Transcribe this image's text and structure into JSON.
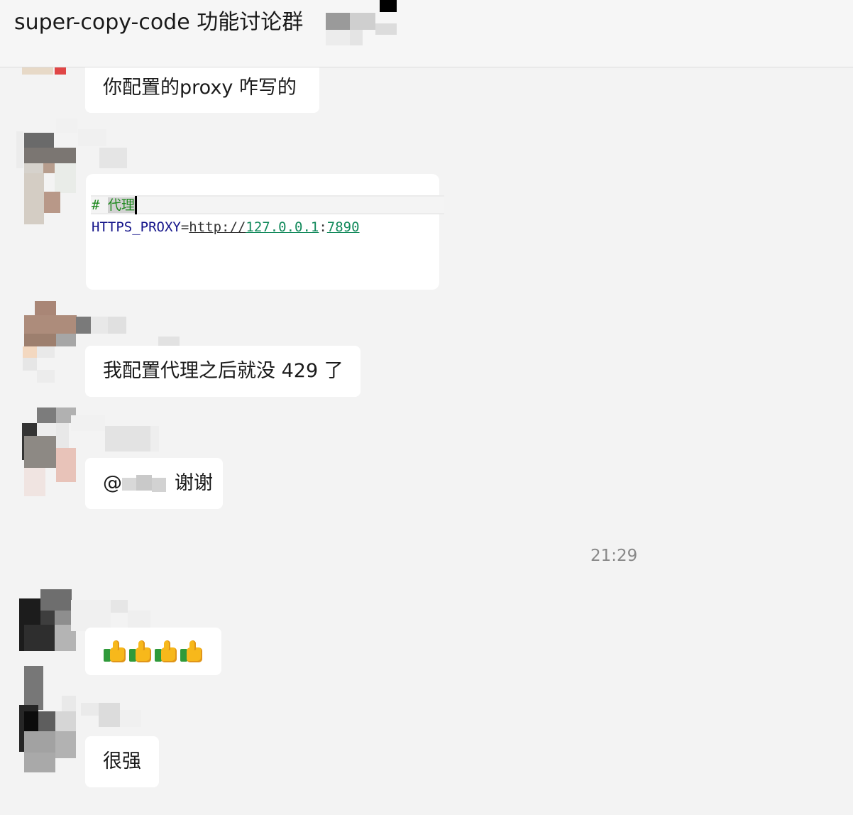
{
  "header": {
    "title": "super-copy-code 功能讨论群"
  },
  "messages": [
    {
      "text": "你配置的proxy 咋写的"
    },
    {
      "code": {
        "comment_hash": "# ",
        "comment_word": "代理",
        "key": "HTTPS_PROXY",
        "eq": "=",
        "scheme": "http://",
        "host": "127.0.0.1",
        "colon": ":",
        "port": "7890"
      }
    },
    {
      "text": "我配置代理之后就没 429 了"
    },
    {
      "at": "@",
      "text": "谢谢"
    },
    {
      "emoji_count": 4
    },
    {
      "text": "很强"
    }
  ],
  "timestamp": "21:29",
  "colors": {
    "background": "#f3f3f3",
    "bubble": "#ffffff",
    "timestamp": "#888888",
    "code_comment": "#1f8a1f",
    "code_key": "#14148a",
    "code_number": "#138a5c"
  }
}
